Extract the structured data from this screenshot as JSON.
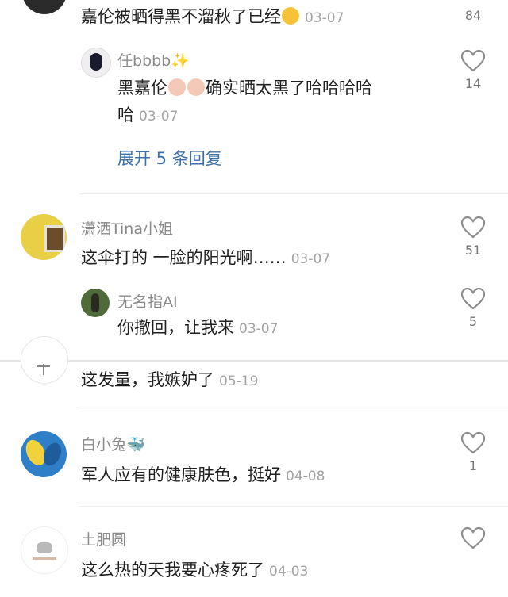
{
  "comments": [
    {
      "text": "嘉伦被晒得黑不溜秋了已经",
      "date": "03-07",
      "likes": "84",
      "reply": {
        "user": "任bbbb✨",
        "text_line1": "黑嘉伦",
        "text_line1b": "确实晒太黑了哈哈哈哈",
        "text_line2": "哈",
        "date": "03-07",
        "likes": "14"
      },
      "expand_label": "展开 5 条回复"
    },
    {
      "user": "潇洒Tina小姐",
      "text": "这伞打的 一脸的阳光啊……",
      "date": "03-07",
      "likes": "51",
      "reply": {
        "user": "无名指AI",
        "text": "你撤回，让我来",
        "date": "03-07",
        "likes": "5"
      }
    },
    {
      "text": "这发量，我嫉妒了",
      "date": "05-19"
    },
    {
      "user": "白小兔🐳",
      "text": "军人应有的健康肤色，挺好",
      "date": "04-08",
      "likes": "1"
    },
    {
      "user": "土肥圆",
      "text": "这么热的天我要心疼死了",
      "date": "04-03"
    }
  ],
  "colors": {
    "link": "#3d6fa8",
    "name": "#8a8a8a",
    "date": "#a3a3a3",
    "divider": "#ececec"
  }
}
